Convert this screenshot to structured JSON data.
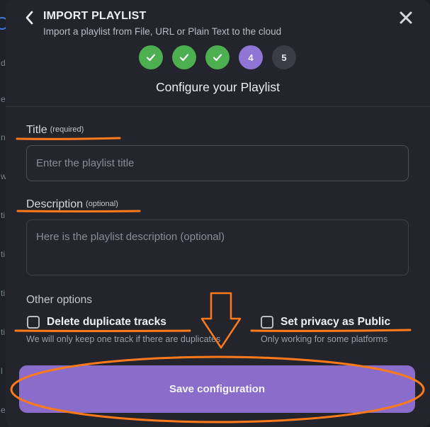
{
  "header": {
    "title": "IMPORT PLAYLIST",
    "subtitle": "Import a playlist from File, URL or Plain Text to the cloud",
    "back_icon": "chevron-left-icon",
    "close_icon": "close-icon"
  },
  "steps": [
    {
      "label": "",
      "state": "done"
    },
    {
      "label": "",
      "state": "done"
    },
    {
      "label": "",
      "state": "done"
    },
    {
      "label": "4",
      "state": "active"
    },
    {
      "label": "5",
      "state": "todo"
    }
  ],
  "step_title": "Configure your Playlist",
  "form": {
    "title_label": "Title",
    "title_hint": "(required)",
    "title_placeholder": "Enter the playlist title",
    "description_label": "Description",
    "description_hint": "(optional)",
    "description_placeholder": "Here is the playlist description (optional)",
    "other_options": "Other options",
    "duplicate_label": "Delete duplicate tracks",
    "duplicate_hint": "We will only keep one track if there are duplicates",
    "public_label": "Set privacy as Public",
    "public_hint": "Only working for some platforms",
    "save_label": "Save configuration"
  },
  "background_sidebar": [
    "d",
    "e",
    "n",
    "w",
    "ti",
    "ti",
    "ti",
    "ti",
    "ti",
    "l",
    "e"
  ],
  "colors": {
    "accent": "#8a6ccb",
    "step_done": "#4caf50",
    "step_active": "#9175d6",
    "annotation": "#ff7a1a"
  }
}
